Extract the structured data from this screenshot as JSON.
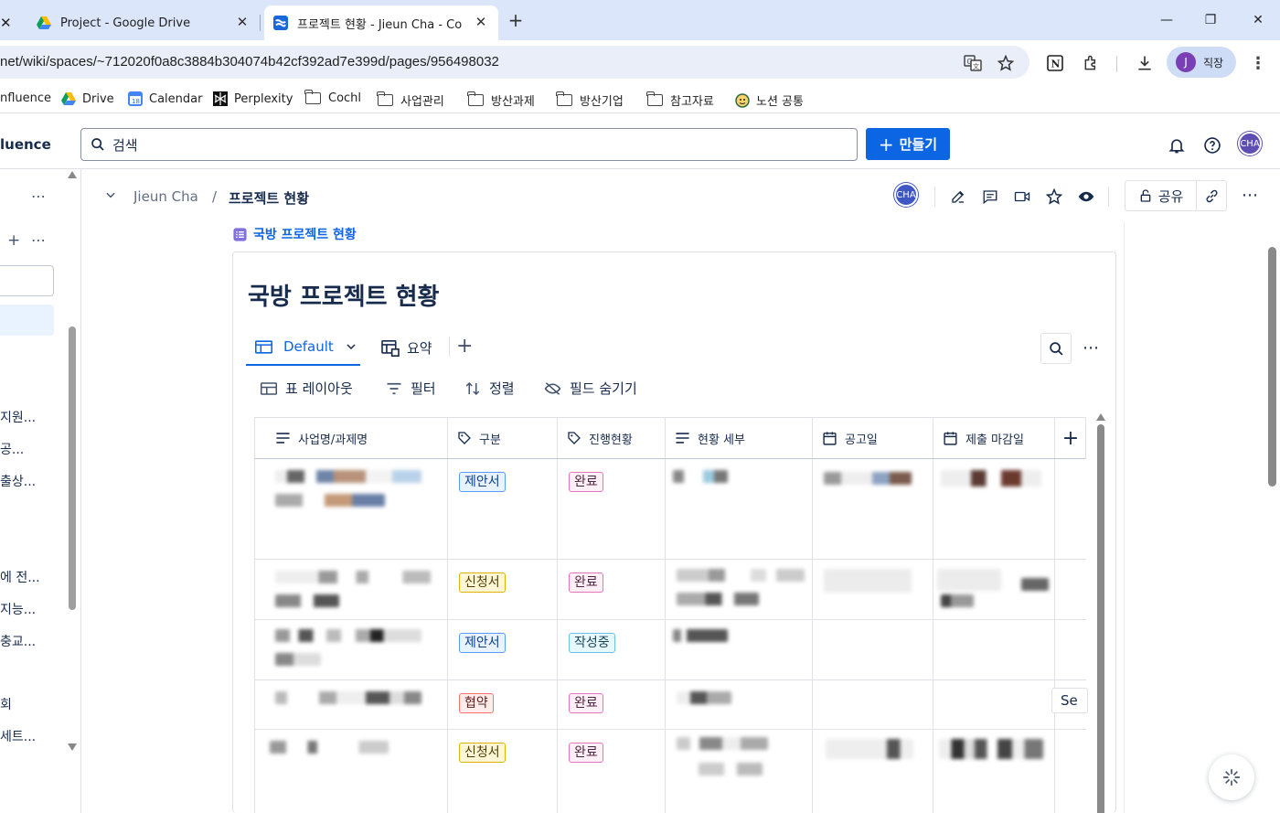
{
  "browser": {
    "tabs": [
      {
        "title": "Project - Google Drive",
        "active": false
      },
      {
        "title": "프로젝트 현황 - Jieun Cha - Co",
        "active": true
      }
    ],
    "url": "net/wiki/spaces/~712020f0a8c3884b304074b42cf392ad7e399d/pages/956498032",
    "profile_initial": "J",
    "profile_label": "직장",
    "bookmarks": [
      "nfluence",
      "Drive",
      "Calendar",
      "Perplexity",
      "Cochl",
      "사업관리",
      "방산과제",
      "방산기업",
      "참고자료",
      "노션 공통"
    ]
  },
  "header": {
    "app_name": "luence",
    "search_placeholder": "검색",
    "create_label": "만들기",
    "avatar": "CHA"
  },
  "sidebar": {
    "items": [
      "지원...",
      "공...",
      "출상...",
      "에 전...",
      "지능...",
      "충교...",
      "회",
      "세트..."
    ]
  },
  "breadcrumb": {
    "parent": "Jieun Cha",
    "current": "프로젝트 현황",
    "avatar": "CHA",
    "share_label": "공유"
  },
  "database": {
    "link_label": "국방 프로젝트 현황",
    "title": "국방 프로젝트 현황",
    "views": [
      "Default",
      "요약"
    ],
    "toolbar": {
      "layout": "표 레이아웃",
      "filter": "필터",
      "sort": "정렬",
      "hide": "필드 숨기기"
    },
    "columns": [
      "사업명/과제명",
      "구분",
      "진행현황",
      "현황 세부",
      "공고일",
      "제출 마감일"
    ],
    "rows": [
      {
        "type": "제안서",
        "type_color": "blue",
        "status": "완료",
        "status_color": "pink"
      },
      {
        "type": "신청서",
        "type_color": "yellow",
        "status": "완료",
        "status_color": "pink"
      },
      {
        "type": "제안서",
        "type_color": "blue",
        "status": "작성중",
        "status_color": "teal"
      },
      {
        "type": "협약",
        "type_color": "red",
        "status": "완료",
        "status_color": "pink"
      },
      {
        "type": "신청서",
        "type_color": "yellow",
        "status": "완료",
        "status_color": "pink"
      }
    ],
    "overflow_text": "Se"
  }
}
